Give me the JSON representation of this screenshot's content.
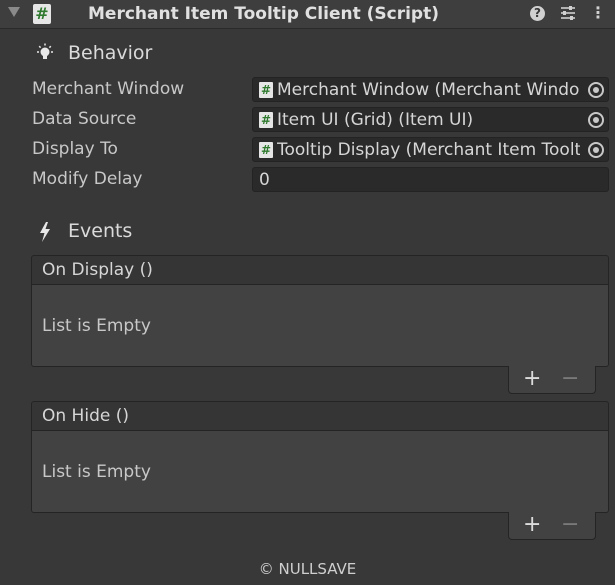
{
  "header": {
    "title": "Merchant Item Tooltip Client (Script)",
    "script_icon": "#",
    "help_icon": "?",
    "more_icon": "⋮"
  },
  "behavior": {
    "title": "Behavior",
    "fields": [
      {
        "label": "Merchant Window",
        "value": "Merchant Window (Merchant Window)",
        "icon": "#"
      },
      {
        "label": "Data Source",
        "value": "Item UI (Grid) (Item UI)",
        "icon": "#"
      },
      {
        "label": "Display To",
        "value": "Tooltip Display (Merchant Item Tooltip Display)",
        "icon": "#"
      }
    ],
    "modify_delay": {
      "label": "Modify Delay",
      "value": "0"
    }
  },
  "events": {
    "title": "Events",
    "lists": [
      {
        "label": "On Display ()",
        "empty_text": "List is Empty",
        "add": "+",
        "remove": "−"
      },
      {
        "label": "On Hide ()",
        "empty_text": "List is Empty",
        "add": "+",
        "remove": "−"
      }
    ]
  },
  "footer": {
    "copyright": "© NULLSAVE"
  }
}
